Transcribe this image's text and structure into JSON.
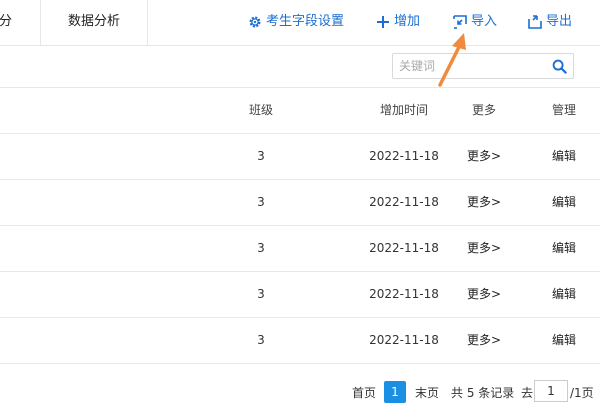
{
  "tabs": {
    "partial": "分",
    "analysis": "数据分析"
  },
  "toolbar": {
    "fields_label": "考生字段设置",
    "add_label": "增加",
    "import_label": "导入",
    "export_label": "导出"
  },
  "search": {
    "placeholder": "关键词"
  },
  "table": {
    "headers": {
      "class": "班级",
      "time": "增加时间",
      "more": "更多",
      "manage": "管理"
    },
    "rows": [
      {
        "class": "3",
        "time": "2022-11-18",
        "more": "更多>",
        "manage": "编辑"
      },
      {
        "class": "3",
        "time": "2022-11-18",
        "more": "更多>",
        "manage": "编辑"
      },
      {
        "class": "3",
        "time": "2022-11-18",
        "more": "更多>",
        "manage": "编辑"
      },
      {
        "class": "3",
        "time": "2022-11-18",
        "more": "更多>",
        "manage": "编辑"
      },
      {
        "class": "3",
        "time": "2022-11-18",
        "more": "更多>",
        "manage": "编辑"
      }
    ]
  },
  "pagination": {
    "first": "首页",
    "current": "1",
    "last": "末页",
    "total": "共 5 条记录",
    "goto": "去",
    "page_input": "1",
    "suffix": "/1页"
  },
  "colors": {
    "accent": "#1b6fd1",
    "active_page": "#1b8fe4",
    "annotation_arrow": "#f08a3c"
  }
}
